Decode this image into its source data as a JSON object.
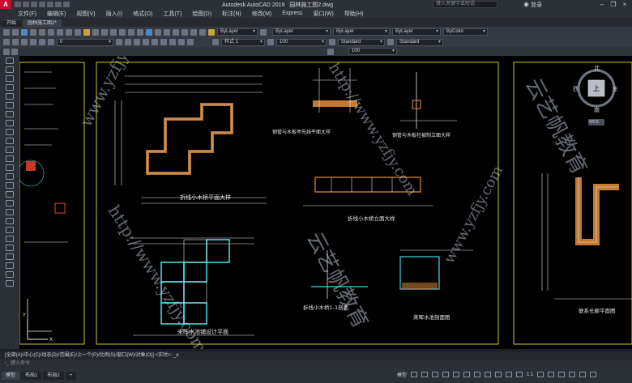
{
  "title_bar": {
    "app_title": "Autodesk AutoCAD 2019",
    "file_name": "园林施工图2.dwg",
    "search_placeholder": "键入关键字或短语",
    "login_label": "登录"
  },
  "menu": [
    "文件(F)",
    "编辑(E)",
    "视图(V)",
    "插入(I)",
    "格式(O)",
    "工具(T)",
    "绘图(D)",
    "标注(N)",
    "修改(M)",
    "Express",
    "窗口(W)",
    "帮助(H)"
  ],
  "doc_tabs": [
    "开始",
    "园林施工图2*"
  ],
  "toolbar": {
    "layer_value": "0",
    "color_value": "ByLayer",
    "linetype_value": "ByLayer",
    "lineweight_value": "ByLayer",
    "plotstyle_value": "ByColor",
    "textstyle_value": "样式 1",
    "scale_value": "100",
    "dimstyle_value": "Standard",
    "tablestyle_value": "Standard",
    "field_value": "100"
  },
  "viewcube": {
    "north": "北",
    "south": "南",
    "east": "东",
    "west": "西",
    "face": "上",
    "wcs": "WCS"
  },
  "drawing_labels": {
    "plan_title_1": "折线小木桥平面大样",
    "plan_title_2": "来晖水池铺设计平面",
    "elev_title_1": "钢管与木板亭先线平面大样",
    "elev_title_2": "钢管与木板柱被制立面大样",
    "elev_title_3": "折线小木桥立面大样",
    "section_title_1": "折线小木桥1-1剖面",
    "section_title_2": "来晖水池剖面图",
    "right_title": "联系长廊平面图"
  },
  "watermarks": [
    "www.yzfjy.com",
    "http://www.yzfjy.com",
    "云艺帆教育",
    "云艺帆教育",
    "http://www.yzfjy.com",
    "www.yzfjy.com"
  ],
  "command": {
    "history": "[全部(A)/中心(C)/动态(D)/范围(E)/上一个(P)/比例(S)/窗口(W)/对象(O)] <实时>: _e",
    "prompt": "键入命令"
  },
  "layout_tabs": [
    "模型",
    "布局1",
    "布局2"
  ],
  "status": {
    "model_label": "模型",
    "scale_label": "1:1"
  },
  "colors": {
    "accent": "#c8102e",
    "canvas": "#000000",
    "frame": "#c9c92a",
    "line_cyan": "#3fd9e0",
    "line_white": "#e6e6e6",
    "hatch_orange": "#c57a32",
    "hatch_red": "#c23a2a"
  }
}
